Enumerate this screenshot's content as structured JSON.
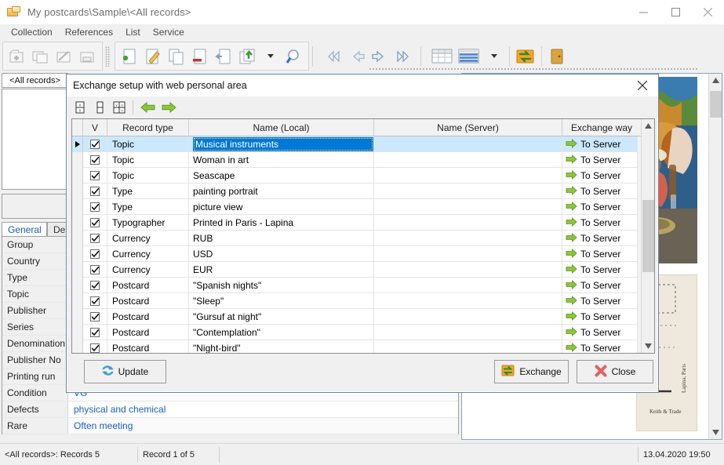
{
  "window": {
    "title": "My postcards\\Sample\\<All records>",
    "icon": "folder-cards-icon",
    "minimize_label": "Minimize",
    "maximize_label": "Maximize",
    "close_label": "Close"
  },
  "menubar": {
    "items": [
      {
        "label": "Collection",
        "name": "menu-collection"
      },
      {
        "label": "References",
        "name": "menu-references"
      },
      {
        "label": "List",
        "name": "menu-list"
      },
      {
        "label": "Service",
        "name": "menu-service"
      }
    ]
  },
  "toolbar": {
    "group1": [
      {
        "icon": "folder-add-icon",
        "label": "New collection",
        "disabled": true
      },
      {
        "icon": "folder-copy-icon",
        "label": "Copy collection",
        "disabled": true
      },
      {
        "icon": "folder-edit-icon",
        "label": "Edit collection",
        "disabled": true
      },
      {
        "icon": "folder-archive-icon",
        "label": "Archive collection",
        "disabled": true
      }
    ],
    "group2": [
      {
        "icon": "record-add-icon",
        "label": "Add record"
      },
      {
        "icon": "record-edit-icon",
        "label": "Edit record"
      },
      {
        "icon": "record-copy-icon",
        "label": "Copy record"
      },
      {
        "icon": "record-delete-icon",
        "label": "Delete record"
      },
      {
        "icon": "record-restore-icon",
        "label": "Restore record"
      },
      {
        "icon": "record-export-icon",
        "label": "Export records"
      },
      {
        "icon": "dropdown-caret-icon",
        "label": "More export options"
      },
      {
        "icon": "search-icon",
        "label": "Find record"
      }
    ],
    "group3": [
      {
        "icon": "nav-first-icon",
        "label": "First record"
      },
      {
        "icon": "nav-prev-icon",
        "label": "Previous record"
      },
      {
        "icon": "nav-next-icon",
        "label": "Next record"
      },
      {
        "icon": "nav-last-icon",
        "label": "Last record"
      }
    ],
    "group4": [
      {
        "icon": "table-view-icon",
        "label": "Table view"
      },
      {
        "icon": "list-view-icon",
        "label": "List view"
      },
      {
        "icon": "dropdown-caret-icon",
        "label": "View options"
      },
      {
        "icon": "exchange-icon",
        "label": "Exchange with web personal area"
      },
      {
        "icon": "exit-door-icon",
        "label": "Exit"
      }
    ]
  },
  "left_panel": {
    "all_records_tab": "<All records>"
  },
  "record_tabs": [
    {
      "label": "General",
      "active": true
    },
    {
      "label": "Desc",
      "active": false
    }
  ],
  "fields": [
    {
      "name": "Group",
      "value": ""
    },
    {
      "name": "Country",
      "value": ""
    },
    {
      "name": "Type",
      "value": ""
    },
    {
      "name": "Topic",
      "value": ""
    },
    {
      "name": "Publisher",
      "value": ""
    },
    {
      "name": "Series",
      "value": ""
    },
    {
      "name": "Denomination",
      "value": ""
    },
    {
      "name": "Publisher No",
      "value": ""
    },
    {
      "name": "Printing run",
      "value": ""
    },
    {
      "name": "Condition",
      "value": "VG"
    },
    {
      "name": "Defects",
      "value": "physical and chemical"
    },
    {
      "name": "Rare",
      "value": "Often meeting"
    }
  ],
  "statusbar": {
    "records": "<All records>: Records 5",
    "record_position": "Record 1 of 5",
    "spacer": "",
    "datetime": "13.04.2020 19:50"
  },
  "dialog": {
    "title": "Exchange setup with web personal area",
    "close_label": "✕",
    "toolbar": [
      {
        "icon": "split-vertical-icon",
        "label": "Check all"
      },
      {
        "icon": "split-single-icon",
        "label": "Uncheck all"
      },
      {
        "icon": "split-quad-icon",
        "label": "Invert selection"
      },
      {
        "icon": "arrow-left-green-icon",
        "label": "To Local"
      },
      {
        "icon": "arrow-right-green-icon",
        "label": "To Server"
      }
    ],
    "columns": [
      {
        "key": "indicator",
        "label": ""
      },
      {
        "key": "checked",
        "label": "V"
      },
      {
        "key": "record_type",
        "label": "Record type"
      },
      {
        "key": "name_local",
        "label": "Name (Local)"
      },
      {
        "key": "name_server",
        "label": "Name (Server)"
      },
      {
        "key": "exchange_way",
        "label": "Exchange way"
      }
    ],
    "rows": [
      {
        "checked": true,
        "record_type": "Topic",
        "name_local": "Musical instruments",
        "name_server": "",
        "exchange_way": "To Server",
        "selected": true
      },
      {
        "checked": true,
        "record_type": "Topic",
        "name_local": "Woman in art",
        "name_server": "",
        "exchange_way": "To Server",
        "selected": false
      },
      {
        "checked": true,
        "record_type": "Topic",
        "name_local": "Seascape",
        "name_server": "",
        "exchange_way": "To Server",
        "selected": false
      },
      {
        "checked": true,
        "record_type": "Type",
        "name_local": "painting portrait",
        "name_server": "",
        "exchange_way": "To Server",
        "selected": false
      },
      {
        "checked": true,
        "record_type": "Type",
        "name_local": "picture view",
        "name_server": "",
        "exchange_way": "To Server",
        "selected": false
      },
      {
        "checked": true,
        "record_type": "Typographer",
        "name_local": "Printed in Paris - Lapina",
        "name_server": "",
        "exchange_way": "To Server",
        "selected": false
      },
      {
        "checked": true,
        "record_type": "Currency",
        "name_local": "RUB",
        "name_server": "",
        "exchange_way": "To Server",
        "selected": false
      },
      {
        "checked": true,
        "record_type": "Currency",
        "name_local": "USD",
        "name_server": "",
        "exchange_way": "To Server",
        "selected": false
      },
      {
        "checked": true,
        "record_type": "Currency",
        "name_local": "EUR",
        "name_server": "",
        "exchange_way": "To Server",
        "selected": false
      },
      {
        "checked": true,
        "record_type": "Postcard",
        "name_local": "\"Spanish nights\"",
        "name_server": "",
        "exchange_way": "To Server",
        "selected": false
      },
      {
        "checked": true,
        "record_type": "Postcard",
        "name_local": "\"Sleep\"",
        "name_server": "",
        "exchange_way": "To Server",
        "selected": false
      },
      {
        "checked": true,
        "record_type": "Postcard",
        "name_local": "\"Gursuf at night\"",
        "name_server": "",
        "exchange_way": "To Server",
        "selected": false
      },
      {
        "checked": true,
        "record_type": "Postcard",
        "name_local": "\"Contemplation\"",
        "name_server": "",
        "exchange_way": "To Server",
        "selected": false
      },
      {
        "checked": true,
        "record_type": "Postcard",
        "name_local": "\"Night-bird\"",
        "name_server": "",
        "exchange_way": "To Server",
        "selected": false
      }
    ],
    "row_dots_label": "···",
    "buttons": {
      "update": "Update",
      "exchange": "Exchange",
      "close": "Close"
    }
  },
  "colors": {
    "accent_selection": "#0078d7",
    "row_highlight": "#cce8ff",
    "field_value_text": "#1a5fb4",
    "arrow_green": "#7cbb2a",
    "window_chrome": "#f0f0f0"
  }
}
